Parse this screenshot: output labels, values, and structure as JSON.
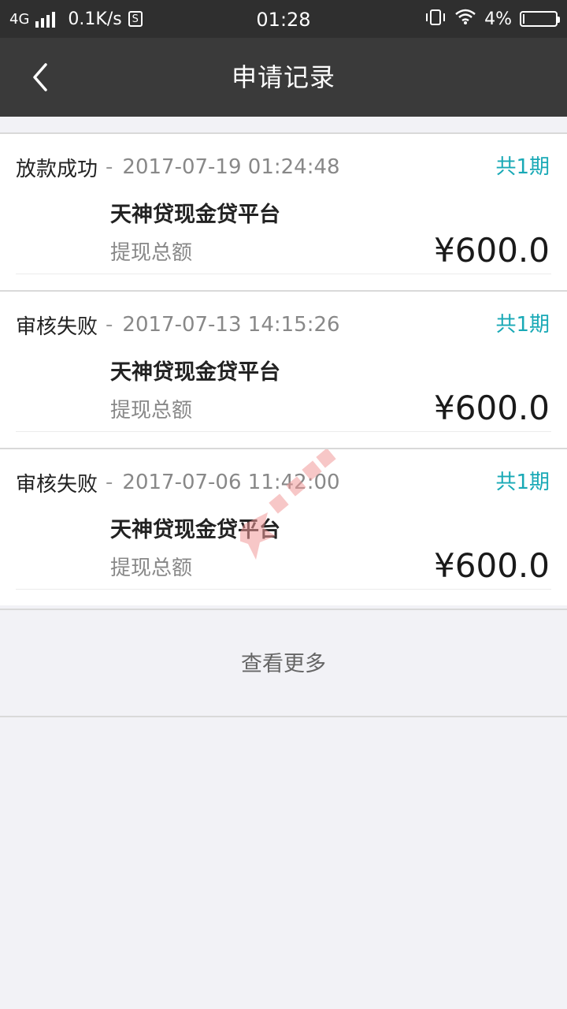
{
  "status_bar": {
    "network": "4G",
    "speed": "0.1K/s",
    "time": "01:28",
    "battery": "4%",
    "battery_level": 0.04
  },
  "nav": {
    "title": "申请记录"
  },
  "records": [
    {
      "status": "放款成功",
      "datetime": "2017-07-19 01:24:48",
      "periods": "共1期",
      "platform": "天神贷现金贷平台",
      "label": "提现总额",
      "amount": "¥600.0"
    },
    {
      "status": "审核失败",
      "datetime": "2017-07-13 14:15:26",
      "periods": "共1期",
      "platform": "天神贷现金贷平台",
      "label": "提现总额",
      "amount": "¥600.0"
    },
    {
      "status": "审核失败",
      "datetime": "2017-07-06 11:42:00",
      "periods": "共1期",
      "platform": "天神贷现金贷平台",
      "label": "提现总额",
      "amount": "¥600.0"
    }
  ],
  "more": {
    "label": "查看更多"
  },
  "colors": {
    "accent": "#19a9b6",
    "navbar": "#3a3a3a",
    "statusbar": "#2f2f2f",
    "background": "#f2f2f6"
  }
}
